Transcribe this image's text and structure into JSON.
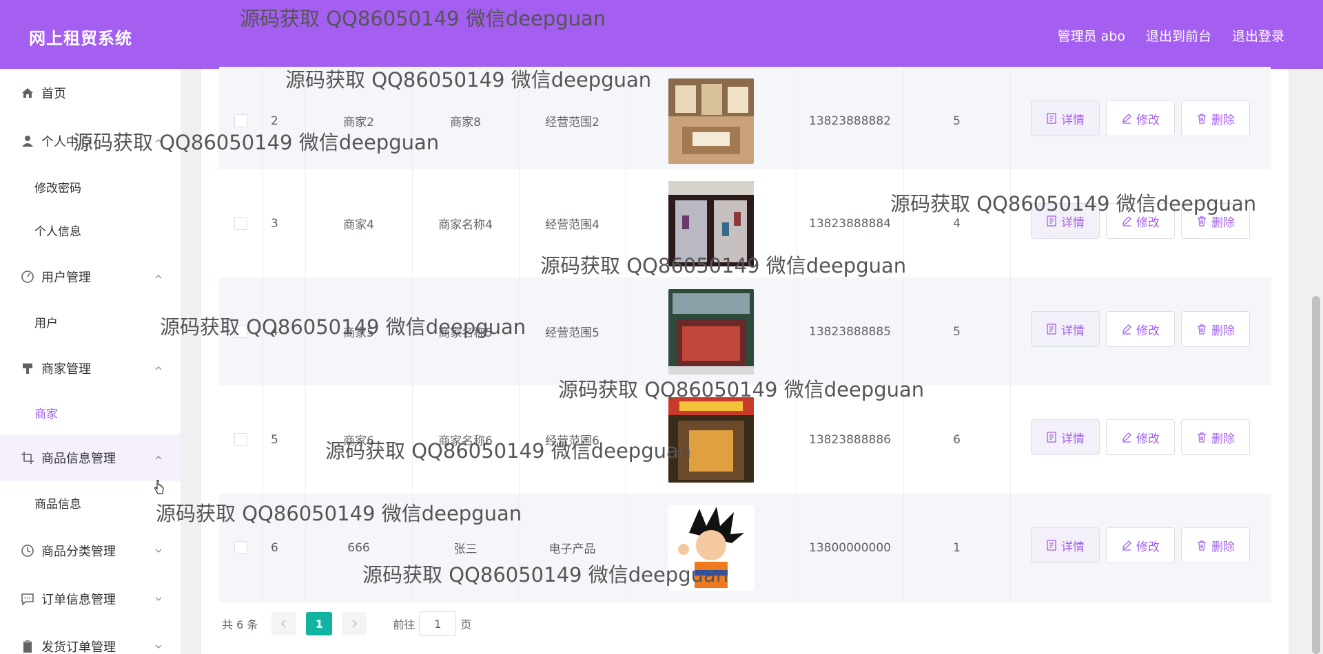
{
  "header": {
    "title": "网上租贸系统",
    "admin": "管理员 abo",
    "to_front": "退出到前台",
    "logout": "退出登录"
  },
  "sidebar": {
    "items": [
      {
        "label": "首页",
        "icon": "home-icon"
      },
      {
        "label": "个人中心",
        "icon": "user-icon"
      },
      {
        "label": "修改密码",
        "sub": true
      },
      {
        "label": "个人信息",
        "sub": true
      },
      {
        "label": "用户管理",
        "icon": "gauge-icon"
      },
      {
        "label": "用户",
        "sub": true
      },
      {
        "label": "商家管理",
        "icon": "brush-icon"
      },
      {
        "label": "商家",
        "sub": true,
        "active": true
      },
      {
        "label": "商品信息管理",
        "icon": "crop-icon"
      },
      {
        "label": "商品信息",
        "sub": true
      },
      {
        "label": "商品分类管理",
        "icon": "clock-icon"
      },
      {
        "label": "订单信息管理",
        "icon": "message-icon"
      },
      {
        "label": "发货订单管理",
        "icon": "clipboard-icon"
      }
    ]
  },
  "table": {
    "rows": [
      {
        "index": "2",
        "account": "商家2",
        "name": "商家8",
        "scope": "经营范围2",
        "phone": "13823888882",
        "level": "5"
      },
      {
        "index": "3",
        "account": "商家4",
        "name": "商家名称4",
        "scope": "经营范围4",
        "phone": "13823888884",
        "level": "4"
      },
      {
        "index": "4",
        "account": "商家5",
        "name": "商家名称5",
        "scope": "经营范围5",
        "phone": "13823888885",
        "level": "5"
      },
      {
        "index": "5",
        "account": "商家6",
        "name": "商家名称6",
        "scope": "经营范围6",
        "phone": "13823888886",
        "level": "6"
      },
      {
        "index": "6",
        "account": "666",
        "name": "张三",
        "scope": "电子产品",
        "phone": "13800000000",
        "level": "1"
      }
    ],
    "actions": {
      "detail": "详情",
      "edit": "修改",
      "delete": "删除"
    }
  },
  "pagination": {
    "total": "共 6 条",
    "current": "1",
    "goto_prefix": "前往",
    "goto_value": "1",
    "goto_suffix": "页"
  },
  "watermark": "源码获取 QQ86050149 微信deepguan",
  "colors": {
    "accent": "#a45ff0",
    "pager_active": "#12b3a0"
  }
}
